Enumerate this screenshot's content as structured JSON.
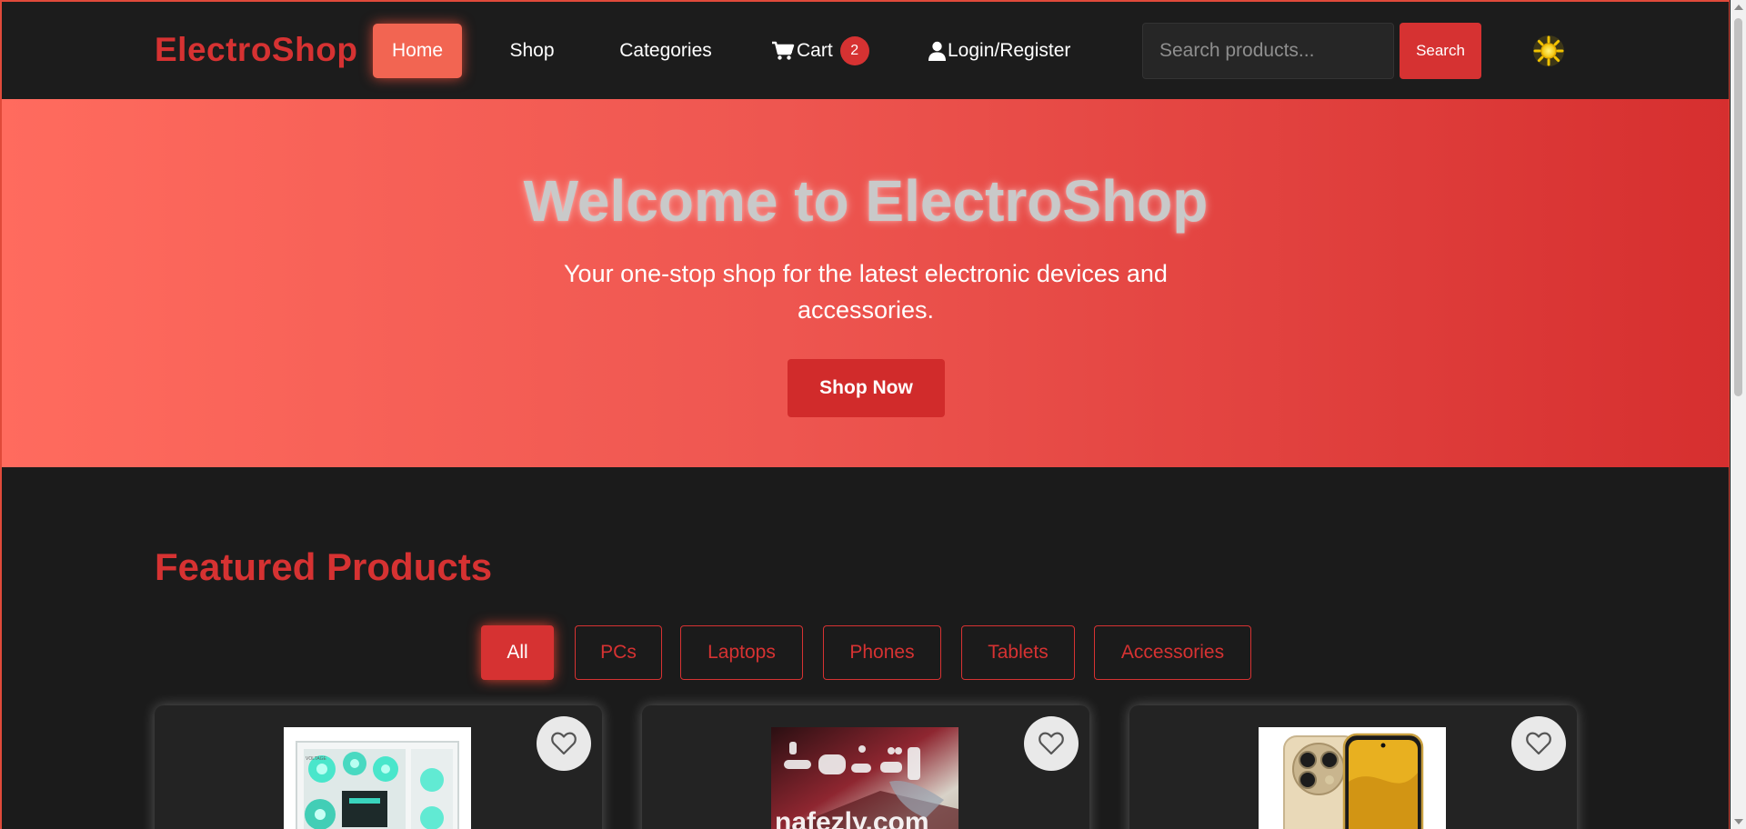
{
  "navbar": {
    "logo": "ElectroShop",
    "links": {
      "home": "Home",
      "shop": "Shop",
      "categories": "Categories",
      "cart": "Cart",
      "login": "Login/Register"
    },
    "cart_count": "2",
    "search": {
      "placeholder": "Search products...",
      "button": "Search"
    },
    "icons": {
      "cart": "cart-icon",
      "user": "user-icon",
      "theme": "sun-icon"
    }
  },
  "hero": {
    "title": "Welcome to ElectroShop",
    "subtitle": "Your one-stop shop for the latest electronic devices and accessories.",
    "cta": "Shop Now"
  },
  "featured": {
    "title": "Featured Products",
    "filters": [
      "All",
      "PCs",
      "Laptops",
      "Phones",
      "Tablets",
      "Accessories"
    ],
    "active_filter": "All",
    "products": [
      {
        "image": "white gaming PC case with teal fans",
        "favorite_icon": "heart-icon"
      },
      {
        "image": "laptop image with nafezly.com watermark",
        "favorite_icon": "heart-icon"
      },
      {
        "image": "gold smartphone with camera module",
        "favorite_icon": "heart-icon"
      }
    ]
  },
  "colors": {
    "accent": "#d63232",
    "home_active": "#f26552",
    "hero_gradient_start": "#ff6b5e",
    "hero_gradient_end": "#d62f2f",
    "background": "#1b1b1b"
  }
}
